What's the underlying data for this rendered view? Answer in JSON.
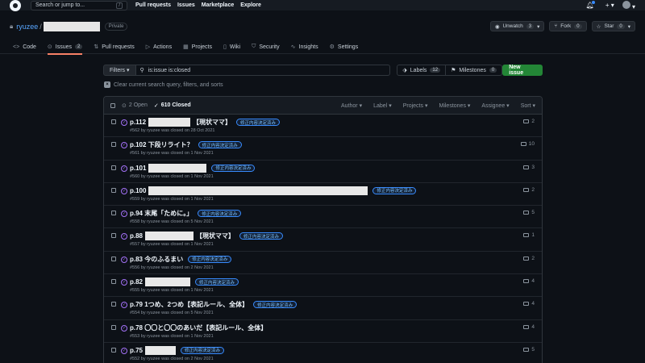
{
  "header": {
    "search_placeholder": "Search or jump to...",
    "search_key": "/",
    "nav": [
      "Pull requests",
      "Issues",
      "Marketplace",
      "Explore"
    ],
    "plus": "+ ▾"
  },
  "repo": {
    "owner": "ryuzee",
    "visibility": "Private",
    "unwatch_label": "Unwatch",
    "unwatch_count": "3",
    "fork_label": "Fork",
    "fork_count": "0",
    "star_label": "Star",
    "star_count": "0"
  },
  "tabs": [
    {
      "icon": "<>",
      "label": "Code"
    },
    {
      "icon": "⊙",
      "label": "Issues",
      "count": "2"
    },
    {
      "icon": "⇅",
      "label": "Pull requests"
    },
    {
      "icon": "▷",
      "label": "Actions"
    },
    {
      "icon": "▦",
      "label": "Projects"
    },
    {
      "icon": "▯",
      "label": "Wiki"
    },
    {
      "icon": "⛉",
      "label": "Security"
    },
    {
      "icon": "∿",
      "label": "Insights"
    },
    {
      "icon": "⚙",
      "label": "Settings"
    }
  ],
  "filters": {
    "filters_label": "Filters",
    "query": "is:issue is:closed",
    "labels_label": "Labels",
    "labels_count": "12",
    "milestones_label": "Milestones",
    "milestones_count": "0",
    "new_issue_label": "New issue",
    "clear_label": "Clear current search query, filters, and sorts"
  },
  "list_header": {
    "open_label": "2 Open",
    "closed_label": "610 Closed",
    "sorts": [
      "Author",
      "Label",
      "Projects",
      "Milestones",
      "Assignee",
      "Sort"
    ]
  },
  "issues": [
    {
      "prefix": "p.112",
      "suffix": "【現状ママ】",
      "label": "修正内容決定済み",
      "meta": "#562 by ryuzee was closed on 28 Oct 2021",
      "comments": "2"
    },
    {
      "prefix": "p.102 下段リライト？",
      "suffix": "",
      "label": "修正内容決定済み",
      "meta": "#561 by ryuzee was closed on 1 Nov 2021",
      "comments": "10"
    },
    {
      "prefix": "p.101",
      "suffix": "",
      "label": "修正内容決定済み",
      "meta": "#560 by ryuzee was closed on 1 Nov 2021",
      "comments": "3"
    },
    {
      "prefix": "p.100",
      "suffix": "",
      "label": "修正内容決定済み",
      "meta": "#559 by ryuzee was closed on 1 Nov 2021",
      "comments": "2"
    },
    {
      "prefix": "p.94 末尾「ために。」",
      "suffix": "",
      "label": "修正内容決定済み",
      "meta": "#558 by ryuzee was closed on 5 Nov 2021",
      "comments": "5"
    },
    {
      "prefix": "p.88",
      "suffix": "【現状ママ】",
      "label": "修正内容決定済み",
      "meta": "#557 by ryuzee was closed on 1 Nov 2021",
      "comments": "1"
    },
    {
      "prefix": "p.83 今のふるまい",
      "suffix": "",
      "label": "修正内容決定済み",
      "meta": "#556 by ryuzee was closed on 2 Nov 2021",
      "comments": "2"
    },
    {
      "prefix": "p.82",
      "suffix": "",
      "label": "修正内容決定済み",
      "meta": "#555 by ryuzee was closed on 1 Nov 2021",
      "comments": "4"
    },
    {
      "prefix": "p.79 1つめ、2つめ【表記ルール、全体】",
      "suffix": "",
      "label": "修正内容決定済み",
      "meta": "#554 by ryuzee was closed on 5 Nov 2021",
      "comments": "4"
    },
    {
      "prefix": "p.78 〇〇と〇〇のあいだ【表記ルール、全体】",
      "suffix": "",
      "label": "",
      "meta": "#553 by ryuzee was closed on 1 Nov 2021",
      "comments": "4"
    },
    {
      "prefix": "p.75",
      "suffix": "",
      "label": "修正内容決定済み",
      "meta": "#552 by ryuzee was closed on 2 Nov 2021",
      "comments": "5"
    }
  ]
}
